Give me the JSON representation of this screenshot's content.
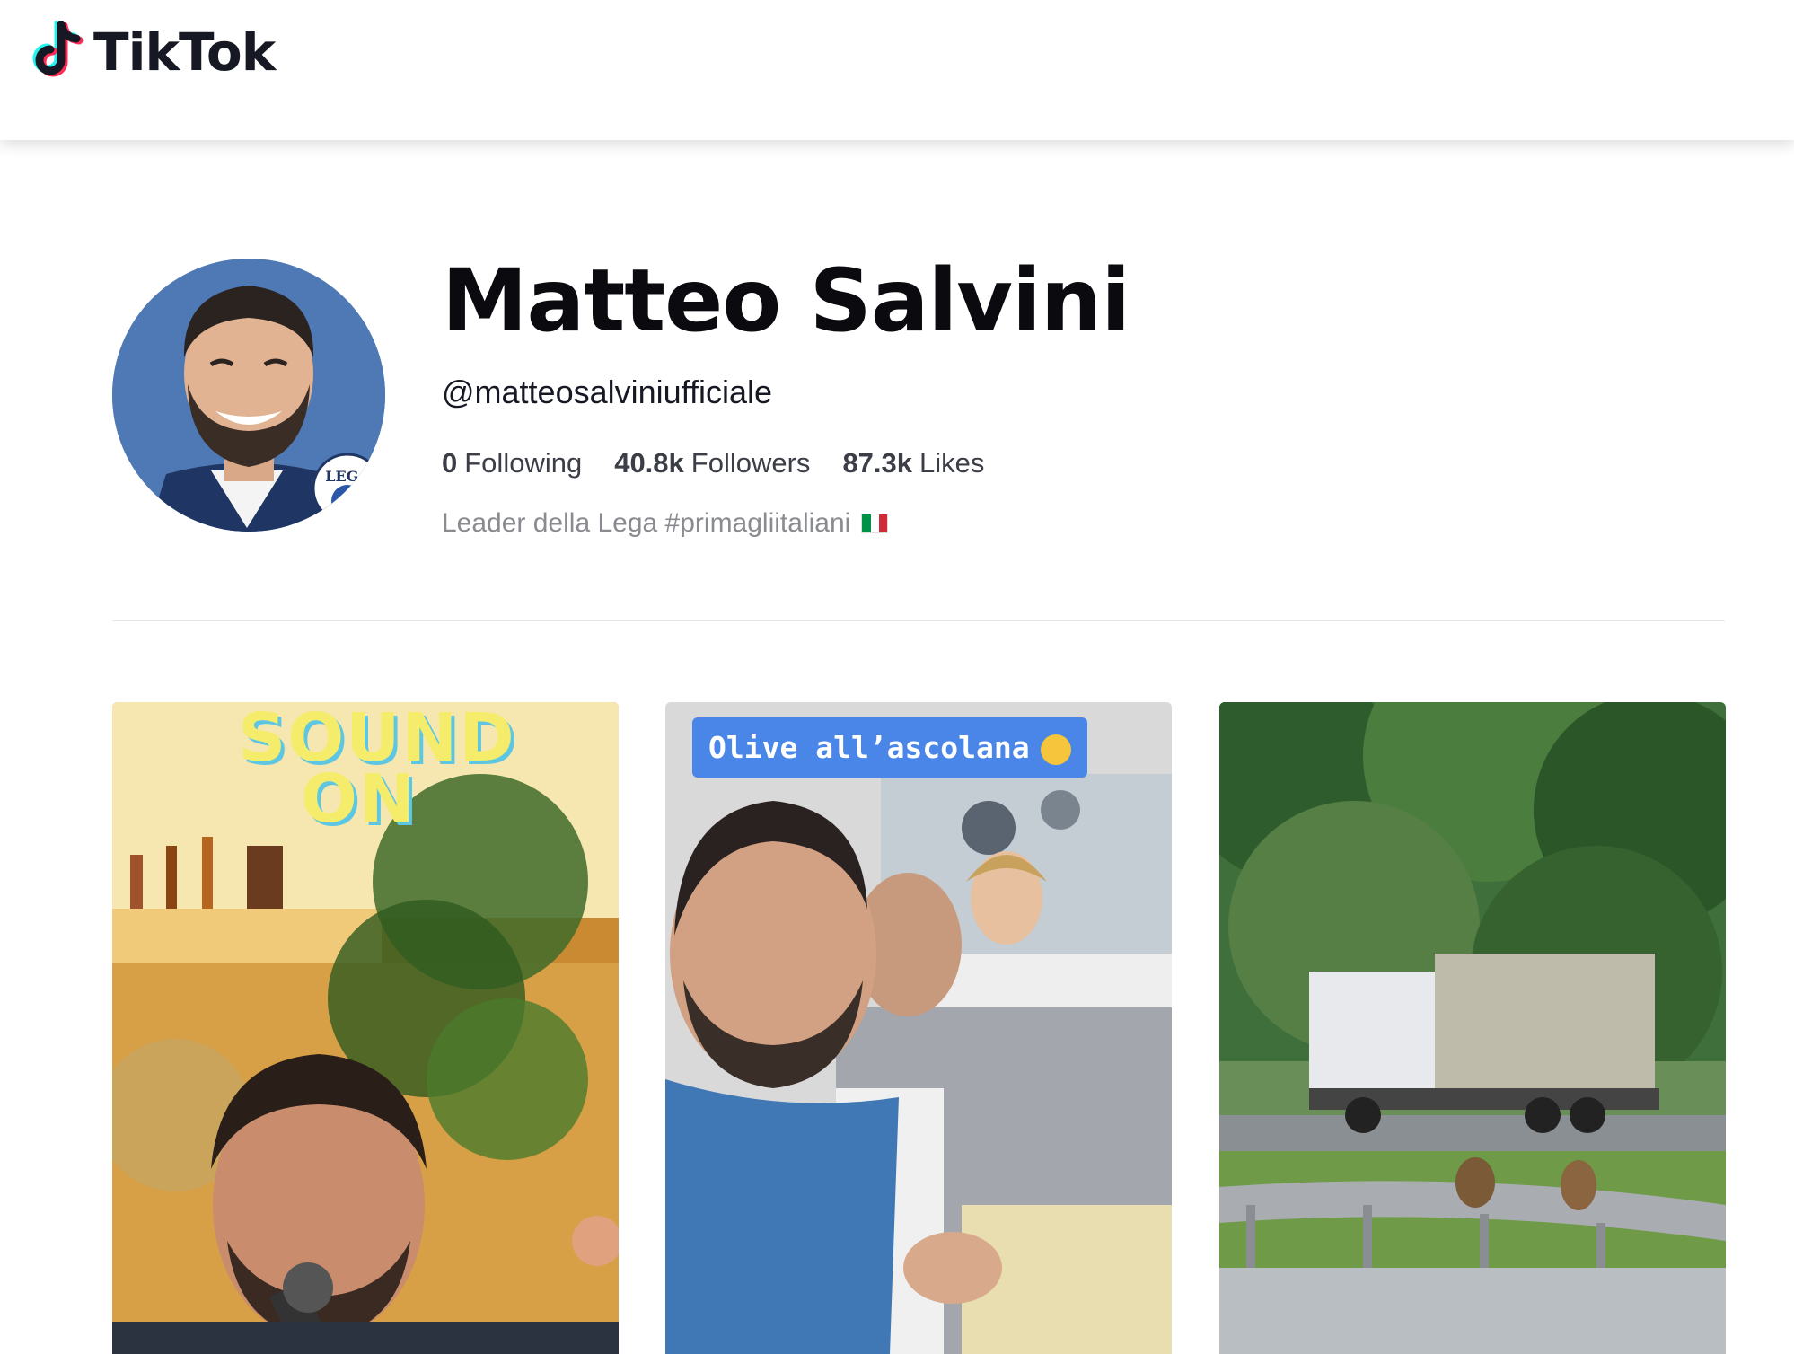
{
  "header": {
    "logo_text": "TikTok"
  },
  "profile": {
    "name": "Matteo Salvini",
    "handle": "@matteosalviniufficiale",
    "following_count": "0",
    "following_label": "Following",
    "followers_count": "40.8k",
    "followers_label": "Followers",
    "likes_count": "87.3k",
    "likes_label": "Likes",
    "bio": "Leader della Lega #primagliitaliani",
    "avatar_badge_text": "LEGA"
  },
  "videos": [
    {
      "sticker_line1": "SOUND",
      "sticker_line2": "ON"
    },
    {
      "caption": "Olive all’ascolana"
    },
    {
      "caption": ""
    }
  ],
  "colors": {
    "tiktok_cyan": "#25f4ee",
    "tiktok_red": "#fe2c55",
    "caption_blue": "#4a86e8",
    "avatar_bg": "#4f79b5"
  }
}
